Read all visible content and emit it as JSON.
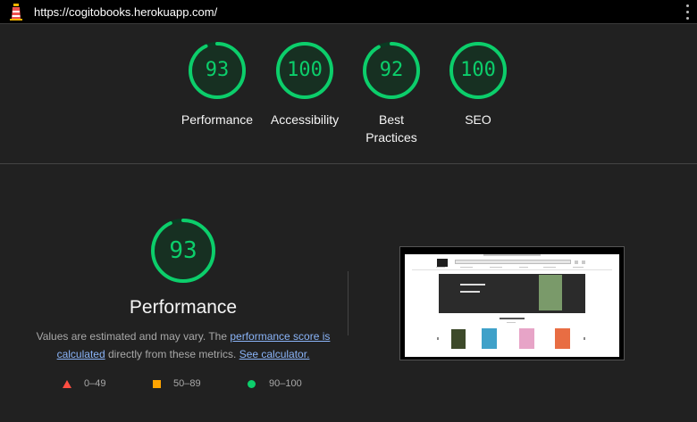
{
  "address_bar": {
    "url": "https://cogitobooks.herokuapp.com/"
  },
  "scores": [
    {
      "label": "Performance",
      "value": "93",
      "fraction": 0.93
    },
    {
      "label": "Accessibility",
      "value": "100",
      "fraction": 1.0
    },
    {
      "label": "Best Practices",
      "value": "92",
      "fraction": 0.92
    },
    {
      "label": "SEO",
      "value": "100",
      "fraction": 1.0
    }
  ],
  "performance": {
    "score": "93",
    "fraction": 0.93,
    "title": "Performance",
    "desc_prefix": "Values are estimated and may vary. The ",
    "link_score": "performance score is calculated",
    "desc_middle": " directly from these metrics. ",
    "link_calculator": "See calculator."
  },
  "legend": {
    "fail": "0–49",
    "average": "50–89",
    "pass": "90–100"
  },
  "colors": {
    "pass": "#0cce6b",
    "average": "#ffa400",
    "fail": "#ff4e42",
    "background": "#212121"
  },
  "icons": [
    "lighthouse-icon",
    "kebab-menu-icon"
  ]
}
